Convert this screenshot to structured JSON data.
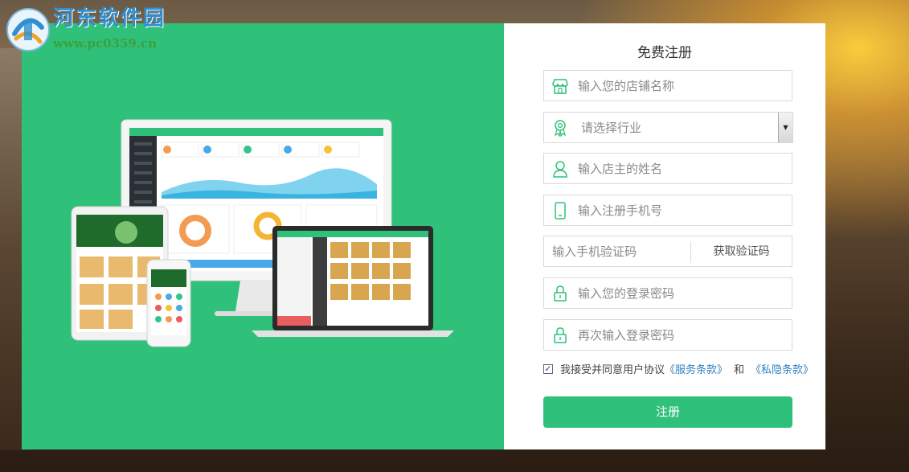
{
  "watermark": {
    "title": "河东软件园",
    "url": "www.pc0359.cn"
  },
  "colors": {
    "brand_green": "#2fc07a",
    "link_blue": "#2f7fbf",
    "watermark_blue": "#2f8fd0",
    "watermark_green": "#3ea03b"
  },
  "form": {
    "title": "免费注册",
    "fields": [
      {
        "icon": "store-icon",
        "placeholder": "输入您的店铺名称"
      },
      {
        "icon": "award-icon",
        "placeholder": "请选择行业",
        "type": "select"
      },
      {
        "icon": "user-icon",
        "placeholder": "输入店主的姓名"
      },
      {
        "icon": "phone-icon",
        "placeholder": "输入注册手机号"
      },
      {
        "icon": "",
        "placeholder": "输入手机验证码"
      },
      {
        "icon": "lock-icon",
        "placeholder": "输入您的登录密码"
      },
      {
        "icon": "lock-icon",
        "placeholder": "再次输入登录密码"
      }
    ],
    "get_code_label": "获取验证码",
    "agree": {
      "checked": true,
      "text": "我接受并同意用户协议",
      "service_terms": "《服务条款》",
      "and": "和",
      "privacy_terms": "《私隐条款》"
    },
    "submit_label": "注册"
  }
}
